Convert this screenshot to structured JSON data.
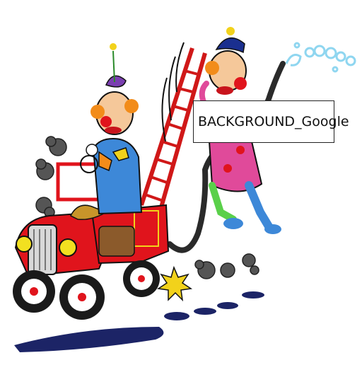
{
  "image": {
    "subject": "clowns-fire-truck-cartoon",
    "colors": {
      "truck_red": "#e0141c",
      "tire_black": "#1a1a1a",
      "ladder_red": "#d01818",
      "hose_dark": "#2a2a2a",
      "water_blue": "#8fd6f0",
      "clown_purple": "#7a3fb0",
      "cap_blue": "#1a2f8f",
      "shadow_navy": "#1c2466",
      "smoke_gray": "#555555",
      "spark_yellow": "#f2d21b"
    }
  },
  "label": {
    "text": "BACKGROUND_Google"
  }
}
